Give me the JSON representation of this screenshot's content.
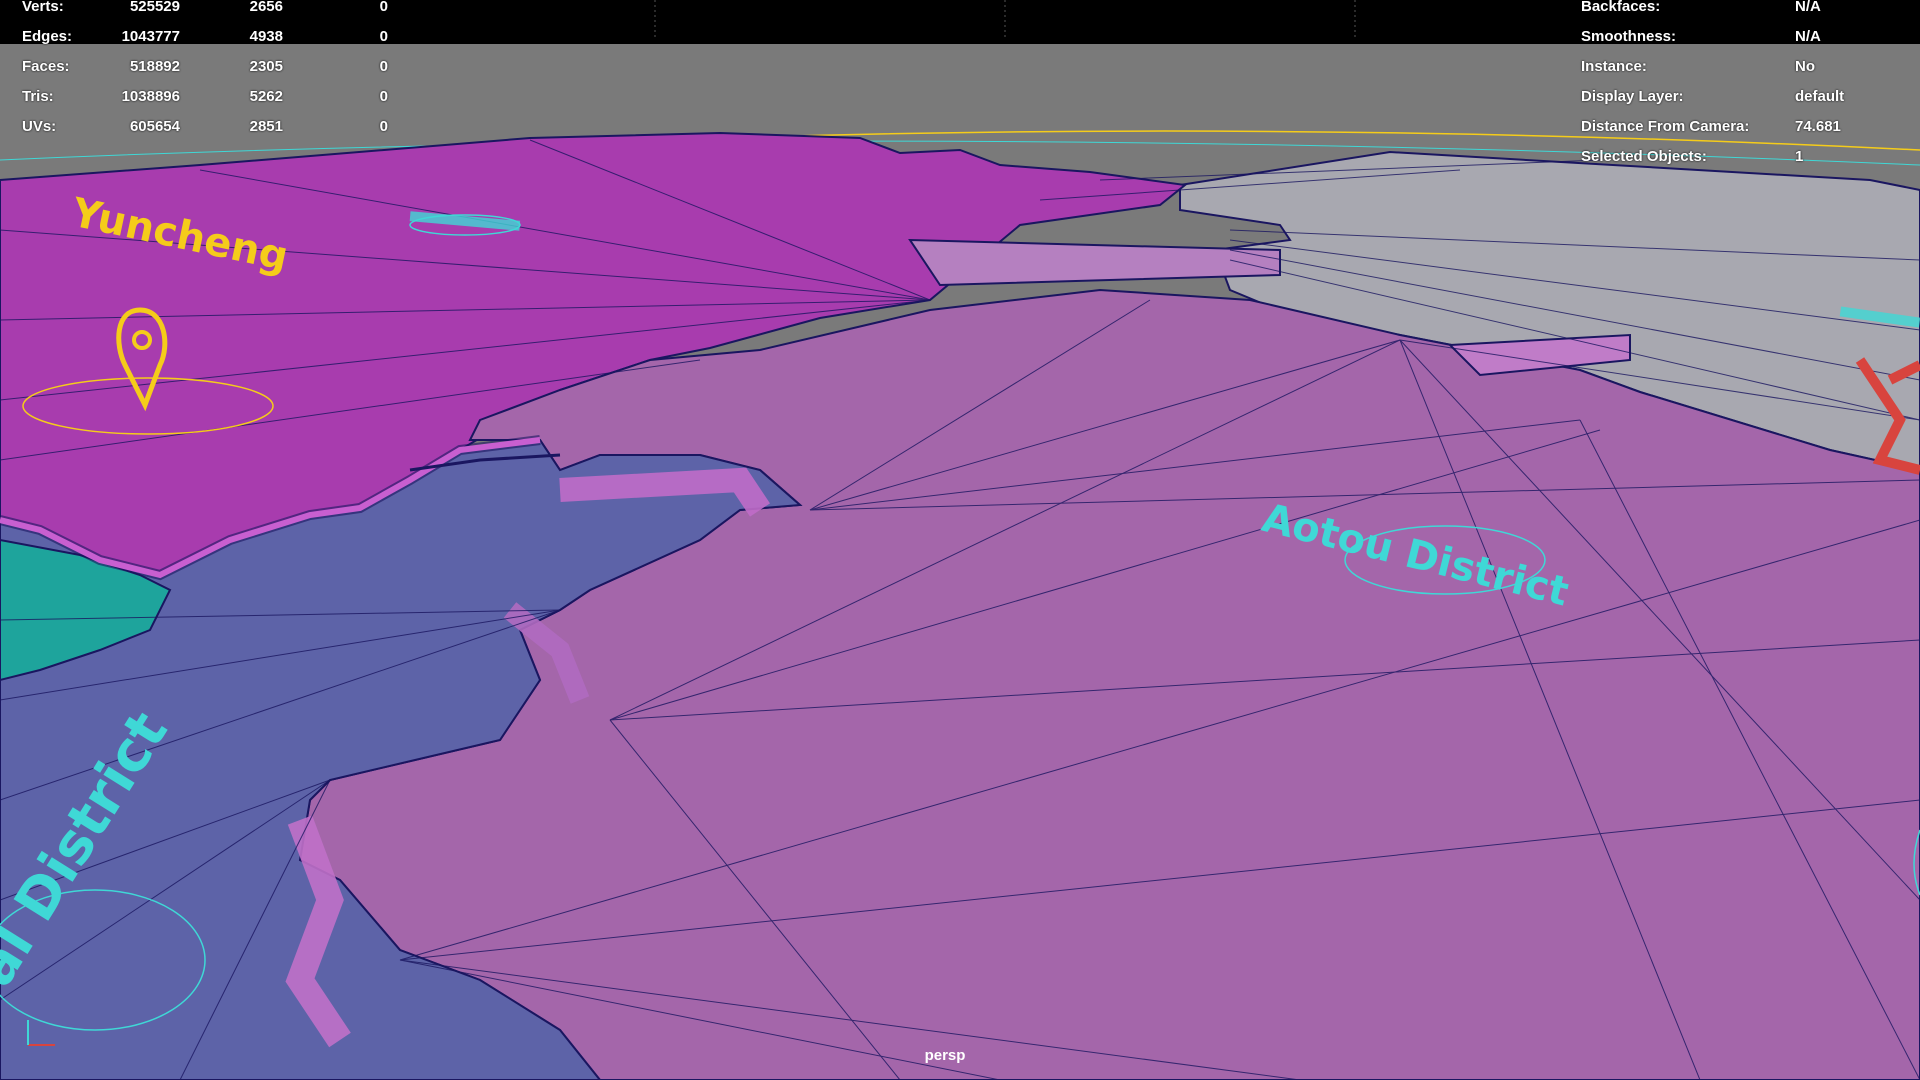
{
  "viewport": {
    "camera": "persp",
    "colors": {
      "top_bar": "#000000",
      "ground": "#7a7a7a",
      "region_magenta": "#a83cae",
      "region_purple": "#a466aa",
      "region_blue": "#5d63a8",
      "region_teal": "#1ea49c",
      "region_grey": "#a8a8b0",
      "wire": "#1a1660",
      "label_yellow": "#f5cc1a",
      "label_cyan": "#3fd8d6",
      "label_red": "#d8443e"
    },
    "annotations": [
      {
        "name": "yellow-text-label",
        "text": "Yuncheng"
      },
      {
        "name": "cyan-text-label",
        "text": "Aotou District"
      },
      {
        "name": "cyan-text-label-bottom-left",
        "text": "al District"
      },
      {
        "name": "location-pin-icon",
        "icon": "map-pin-icon"
      }
    ]
  },
  "stats_hud": {
    "rows": [
      {
        "label": "Verts:",
        "v1": "525529",
        "v2": "2656",
        "v3": "0"
      },
      {
        "label": "Edges:",
        "v1": "1043777",
        "v2": "4938",
        "v3": "0"
      },
      {
        "label": "Faces:",
        "v1": "518892",
        "v2": "2305",
        "v3": "0"
      },
      {
        "label": "Tris:",
        "v1": "1038896",
        "v2": "5262",
        "v3": "0"
      },
      {
        "label": "UVs:",
        "v1": "605654",
        "v2": "2851",
        "v3": "0"
      }
    ]
  },
  "info_hud": {
    "rows": [
      {
        "label": "Backfaces:",
        "value": "N/A"
      },
      {
        "label": "Smoothness:",
        "value": "N/A"
      },
      {
        "label": "Instance:",
        "value": "No"
      },
      {
        "label": "Display Layer:",
        "value": "default"
      },
      {
        "label": "Distance From Camera:",
        "value": "74.681"
      },
      {
        "label": "Selected Objects:",
        "value": "1"
      }
    ]
  }
}
